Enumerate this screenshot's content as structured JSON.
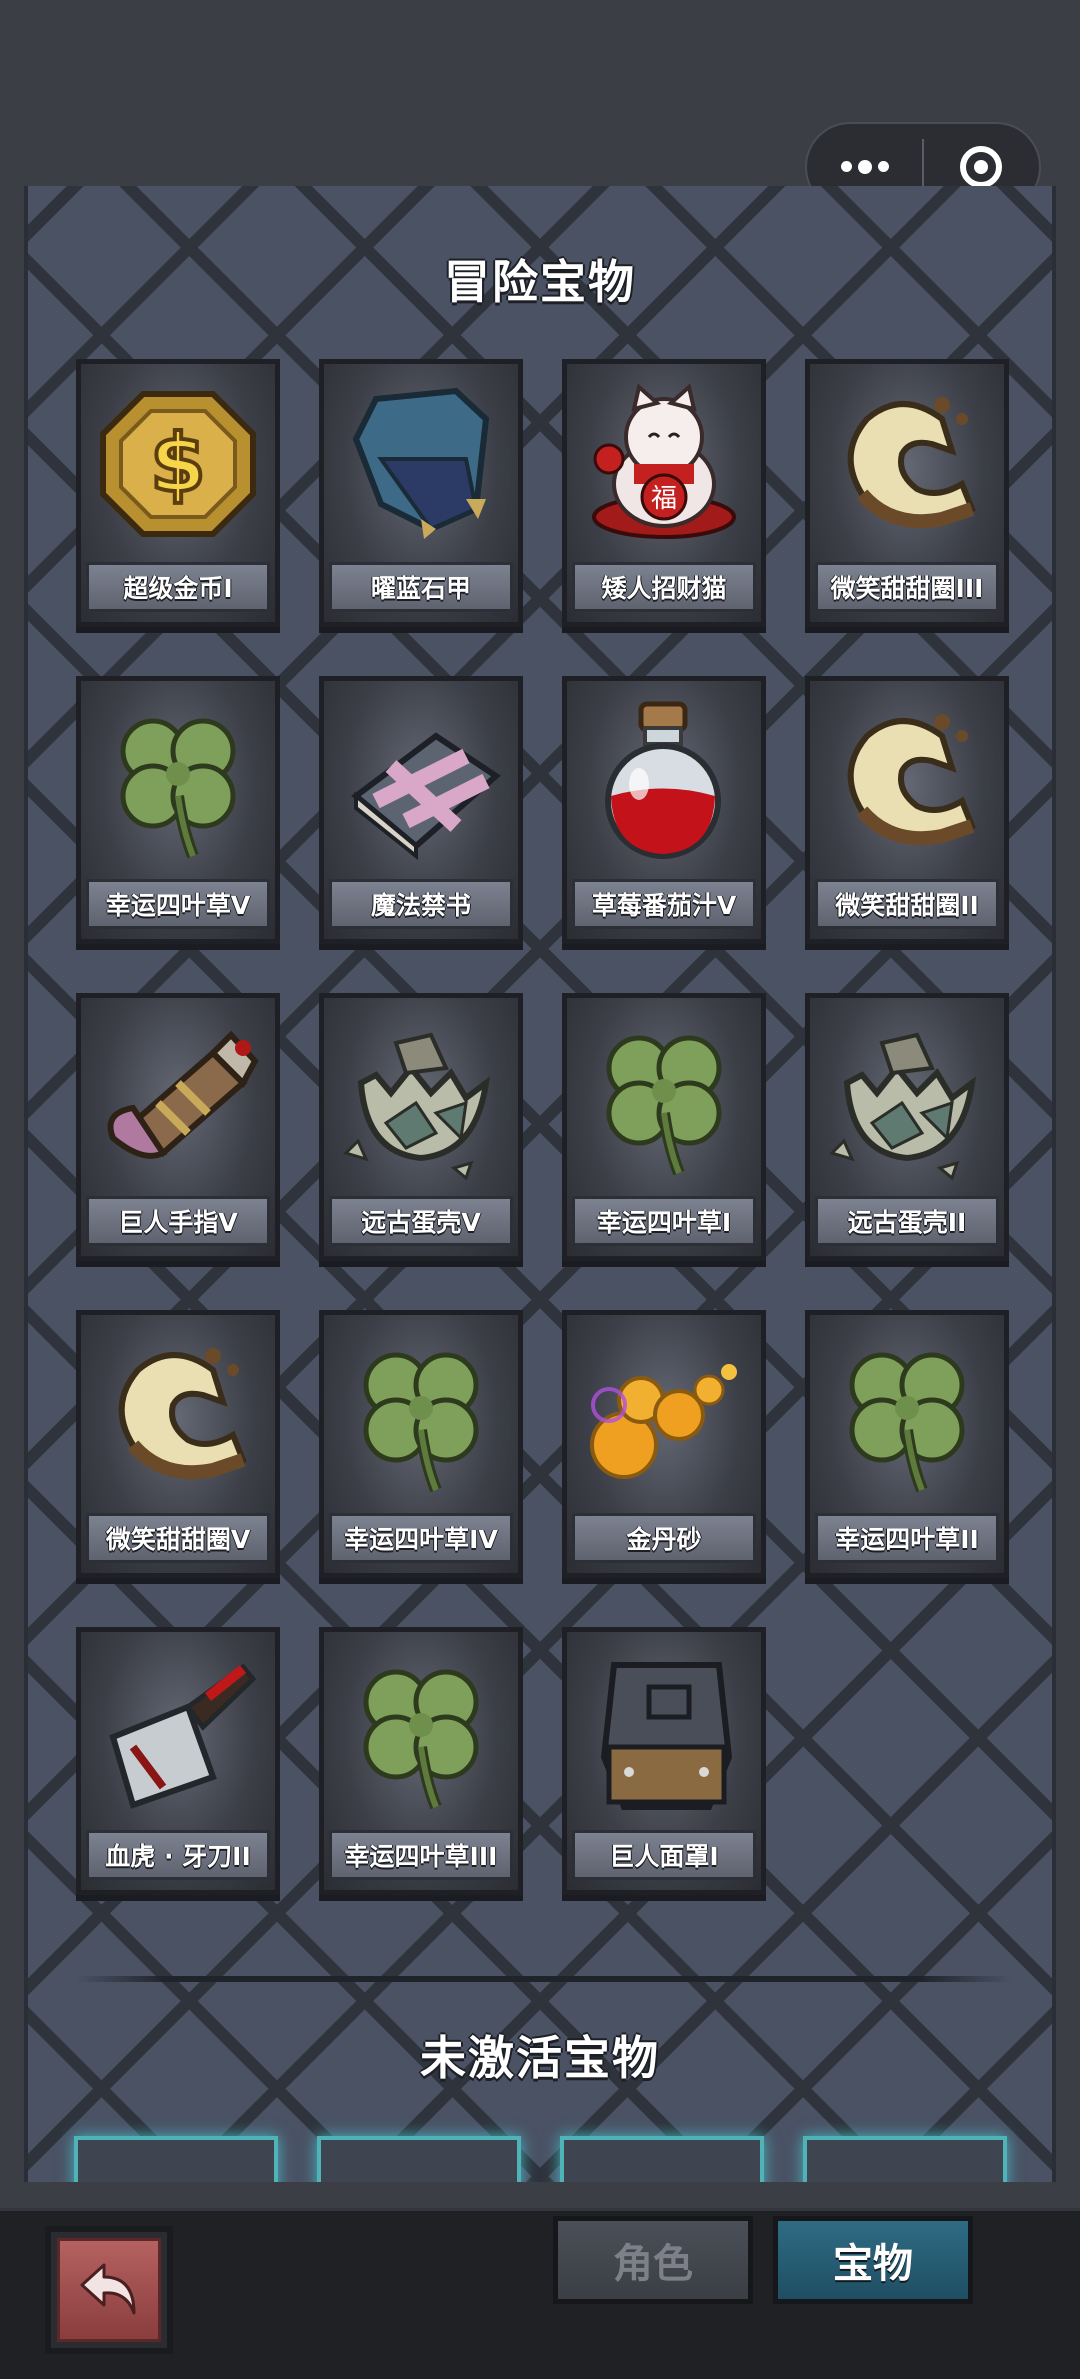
{
  "capsule": {
    "more_icon": "more-dots-icon",
    "close_icon": "close-target-icon"
  },
  "sections": {
    "active_title": "冒险宝物",
    "inactive_title": "未激活宝物"
  },
  "treasures": [
    {
      "name": "超级金币I",
      "icon": "gold-coin-icon"
    },
    {
      "name": "曜蓝石甲",
      "icon": "blue-armor-icon"
    },
    {
      "name": "矮人招财猫",
      "icon": "lucky-cat-icon"
    },
    {
      "name": "微笑甜甜圈III",
      "icon": "donut-icon"
    },
    {
      "name": "幸运四叶草V",
      "icon": "clover-icon"
    },
    {
      "name": "魔法禁书",
      "icon": "spellbook-icon"
    },
    {
      "name": "草莓番茄汁V",
      "icon": "red-potion-icon"
    },
    {
      "name": "微笑甜甜圈II",
      "icon": "donut-icon"
    },
    {
      "name": "巨人手指V",
      "icon": "giant-finger-icon"
    },
    {
      "name": "远古蛋壳V",
      "icon": "eggshell-icon"
    },
    {
      "name": "幸运四叶草I",
      "icon": "clover-icon"
    },
    {
      "name": "远古蛋壳II",
      "icon": "eggshell-icon"
    },
    {
      "name": "微笑甜甜圈V",
      "icon": "donut-icon"
    },
    {
      "name": "幸运四叶草IV",
      "icon": "clover-icon"
    },
    {
      "name": "金丹砂",
      "icon": "golden-pills-icon"
    },
    {
      "name": "幸运四叶草II",
      "icon": "clover-icon"
    },
    {
      "name": "血虎 · 牙刀II",
      "icon": "cleaver-icon"
    },
    {
      "name": "幸运四叶草III",
      "icon": "clover-icon"
    },
    {
      "name": "巨人面罩I",
      "icon": "giant-mask-icon"
    }
  ],
  "bottom": {
    "back_icon": "back-arrow-icon",
    "tab_role": "角色",
    "tab_treasure": "宝物"
  }
}
